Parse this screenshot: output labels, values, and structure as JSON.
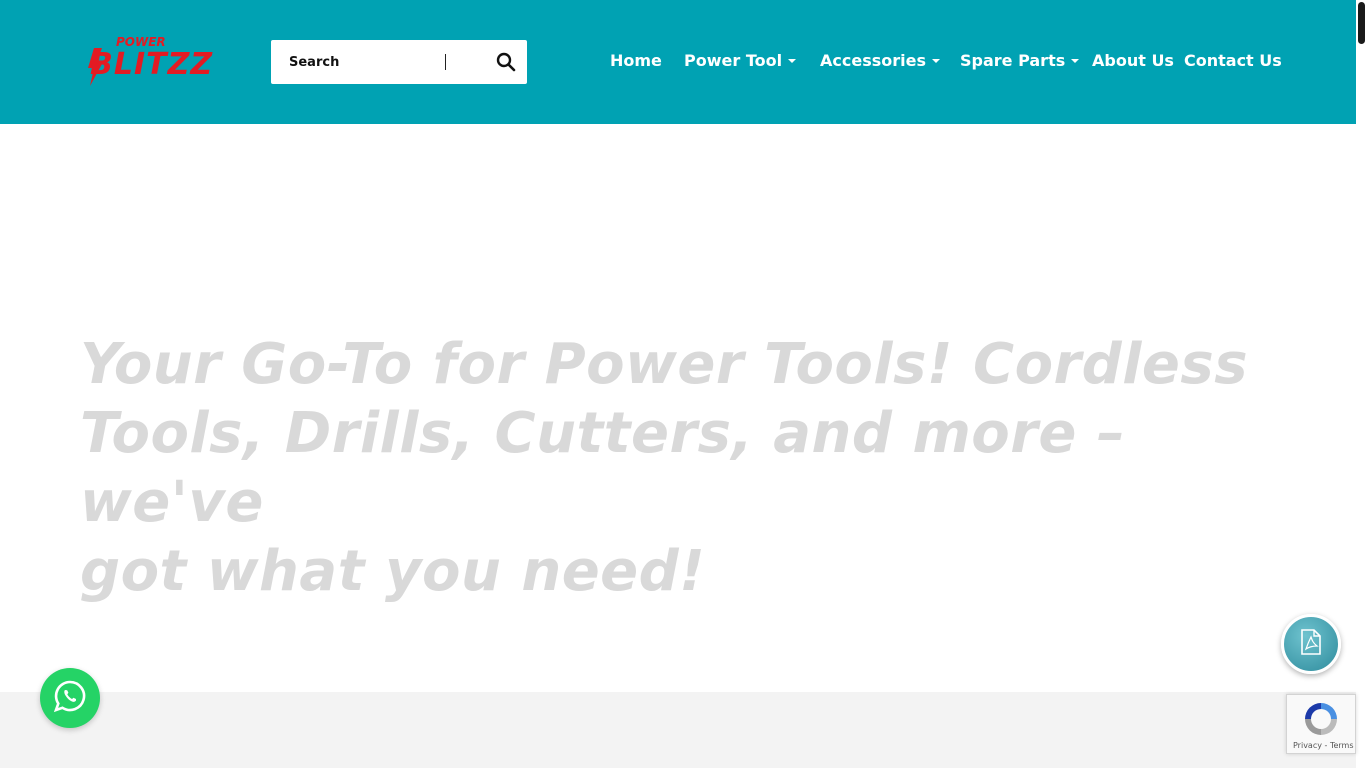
{
  "brand": {
    "logo_top": "POWER",
    "logo_main": "BLITZZ",
    "accent_color": "#e31b23",
    "header_color": "#00a2b3"
  },
  "search": {
    "placeholder": "Search",
    "icon": "search-icon"
  },
  "nav": {
    "items": [
      {
        "label": "Home",
        "dropdown": false
      },
      {
        "label": "Power Tool",
        "dropdown": true
      },
      {
        "label": "Accessories",
        "dropdown": true
      },
      {
        "label": "Spare Parts",
        "dropdown": true
      },
      {
        "label": "About Us",
        "dropdown": false
      },
      {
        "label": "Contact Us",
        "dropdown": false
      }
    ]
  },
  "hero": {
    "line1": "Your Go-To for Power Tools! Cordless",
    "line2": "Tools, Drills, Cutters, and more – we've",
    "line3": "got what you need!"
  },
  "widgets": {
    "whatsapp_icon": "whatsapp-icon",
    "pdf_icon": "pdf-icon",
    "recaptcha_links": "Privacy - Terms"
  }
}
